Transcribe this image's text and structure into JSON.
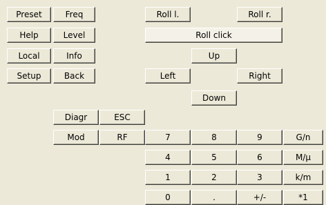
{
  "left_panel": {
    "preset_label": "Preset",
    "freq_label": "Freq",
    "help_label": "Help",
    "level_label": "Level",
    "local_label": "Local",
    "info_label": "Info",
    "setup_label": "Setup",
    "back_label": "Back"
  },
  "function_keys": {
    "diagr_label": "Diagr",
    "esc_label": "ESC",
    "mod_label": "Mod",
    "rf_label": "RF"
  },
  "rotary": {
    "roll_left_label": "Roll l.",
    "roll_right_label": "Roll r.",
    "roll_click_label": "Roll click",
    "up_label": "Up",
    "left_label": "Left",
    "right_label": "Right",
    "down_label": "Down"
  },
  "keypad": {
    "k7": "7",
    "k8": "8",
    "k9": "9",
    "unit_g": "G/n",
    "k4": "4",
    "k5": "5",
    "k6": "6",
    "unit_m": "M/µ",
    "k1": "1",
    "k2": "2",
    "k3": "3",
    "unit_k": "k/m",
    "k0": "0",
    "dot": ".",
    "sign": "+/-",
    "unit_1": "*1"
  }
}
